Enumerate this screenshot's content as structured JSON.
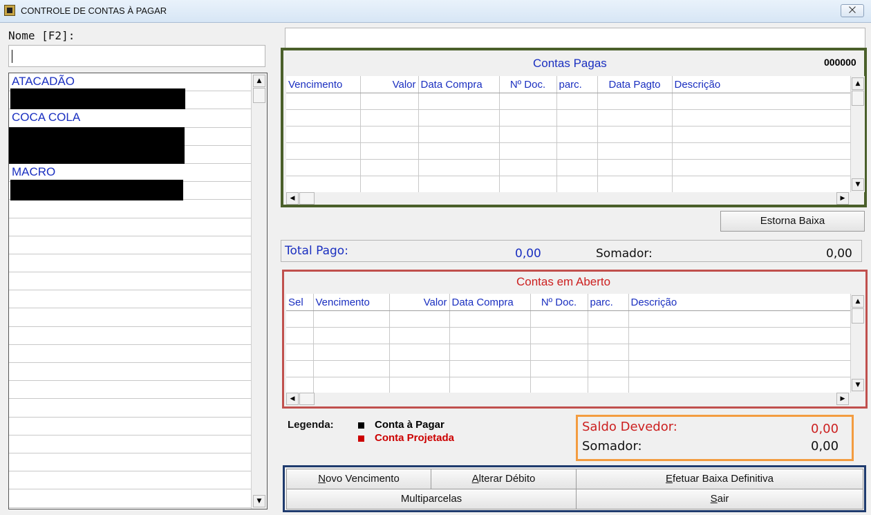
{
  "window": {
    "title": "CONTROLE DE CONTAS À PAGAR",
    "close_glyph": "⨉"
  },
  "nome": {
    "label": "Nome [F2]:",
    "value": ""
  },
  "suppliers": [
    {
      "name": "ATACADÃO"
    },
    {
      "name": "COCA COLA"
    },
    {
      "name": "MACRO"
    }
  ],
  "contas_pagas": {
    "title": "Contas Pagas",
    "counter": "000000",
    "columns": [
      "Vencimento",
      "Valor",
      "Data Compra",
      "Nº Doc.",
      "parc.",
      "Data Pagto",
      "Descrição"
    ]
  },
  "estorna_label": "Estorna Baixa",
  "total_pago": {
    "label": "Total Pago:",
    "value": "0,00",
    "somador_label": "Somador:",
    "somador_value": "0,00"
  },
  "contas_aberto": {
    "title": "Contas em Aberto",
    "columns": [
      "Sel",
      "Vencimento",
      "Valor",
      "Data Compra",
      "Nº Doc.",
      "parc.",
      "Descrição"
    ]
  },
  "legenda": {
    "label": "Legenda:",
    "items": [
      {
        "text": "Conta à Pagar",
        "color": "#000000"
      },
      {
        "text": "Conta Projetada",
        "color": "#cc0000"
      }
    ]
  },
  "saldo": {
    "label": "Saldo Devedor:",
    "value": "0,00",
    "somador_label": "Somador:",
    "somador_value": "0,00"
  },
  "buttons": {
    "novo_key": "N",
    "novo_rest": "ovo Vencimento",
    "alterar_key": "A",
    "alterar_rest": "lterar Débito",
    "efetuar_key": "E",
    "efetuar_rest": "fetuar Baixa Definitiva",
    "multiparcelas": "Multiparcelas",
    "sair_key": "S",
    "sair_rest": "air"
  },
  "colors": {
    "title_blue": "#1a2fc0",
    "title_red": "#cc2020",
    "frame_green": "#4a5f2a",
    "frame_red": "#c0504d",
    "frame_orange": "#f39c40",
    "frame_blue": "#1f3b6e"
  },
  "icons": [
    "app-icon",
    "close-icon",
    "scroll-up-icon",
    "scroll-down-icon",
    "scroll-left-icon",
    "scroll-right-icon"
  ]
}
